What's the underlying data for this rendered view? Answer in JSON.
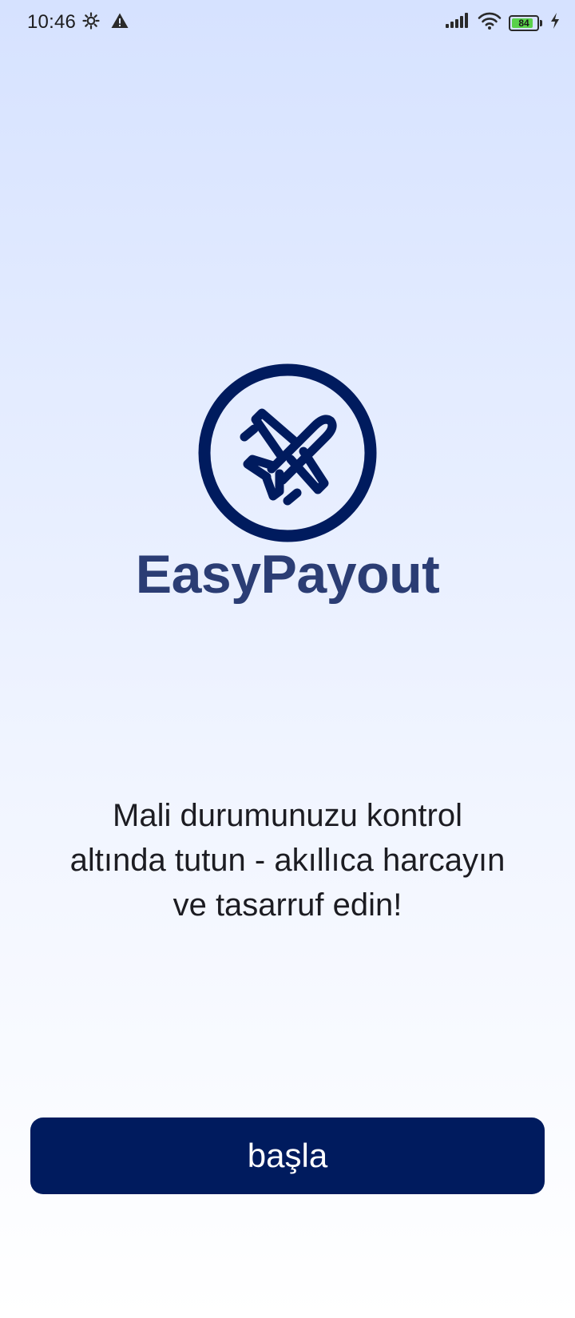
{
  "status_bar": {
    "time": "10:46",
    "left_icons": [
      "settings-gear-icon",
      "warning-icon"
    ],
    "right_icons": [
      "signal-icon",
      "wifi-icon",
      "battery-icon",
      "charging-icon"
    ],
    "battery_level": "84",
    "battery_color": "#59d149"
  },
  "app": {
    "logo_icon": "airplane-icon",
    "name": "EasyPayout",
    "brand_color": "#001b5e"
  },
  "tagline": "Mali durumunuzu kontrol altında tutun - akıllıca harcayın ve tasarruf edin!",
  "start_button": {
    "label": "başla"
  }
}
